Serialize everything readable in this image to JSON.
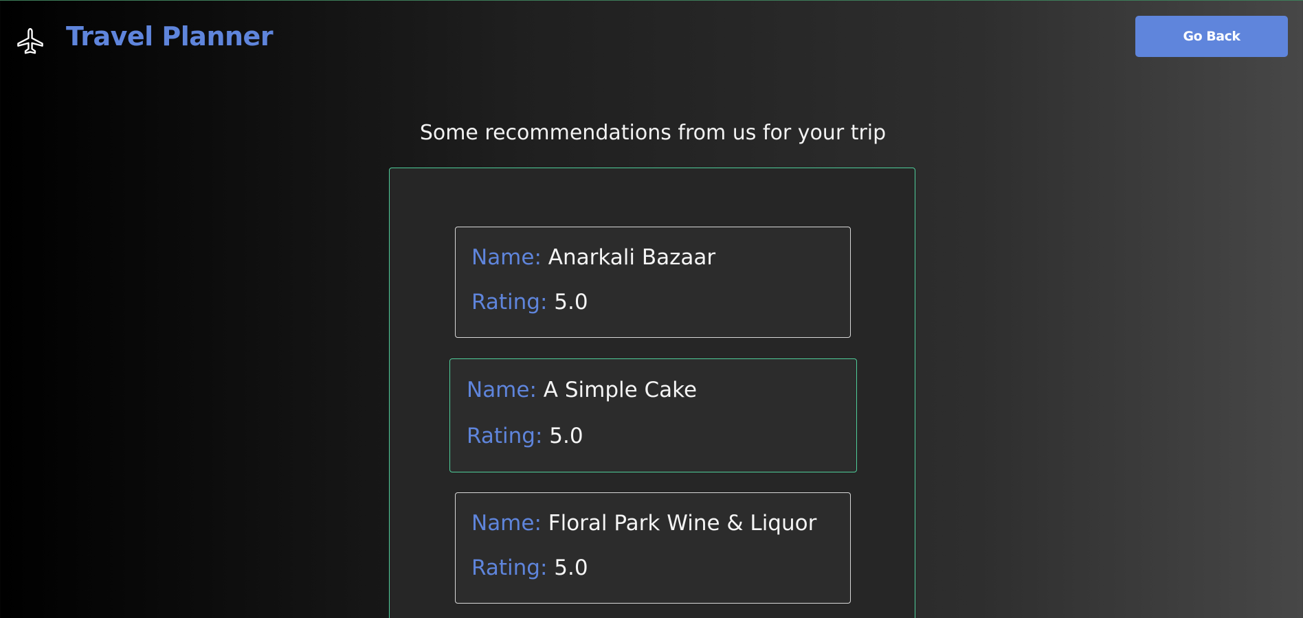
{
  "header": {
    "brand": "Travel Planner",
    "go_back_label": "Go Back"
  },
  "main": {
    "subtitle": "Some recommendations from us for your trip",
    "name_label": "Name:",
    "rating_label": "Rating:",
    "recommendations": [
      {
        "name": "Anarkali Bazaar",
        "rating": "5.0"
      },
      {
        "name": "A Simple Cake",
        "rating": "5.0"
      },
      {
        "name": "Floral Park Wine & Liquor",
        "rating": "5.0"
      }
    ]
  },
  "colors": {
    "accent": "#5f85dc",
    "card_border_active": "#4fcf9b",
    "card_border": "#d9d9d9"
  },
  "icons": {
    "logo": "airplane-icon"
  }
}
